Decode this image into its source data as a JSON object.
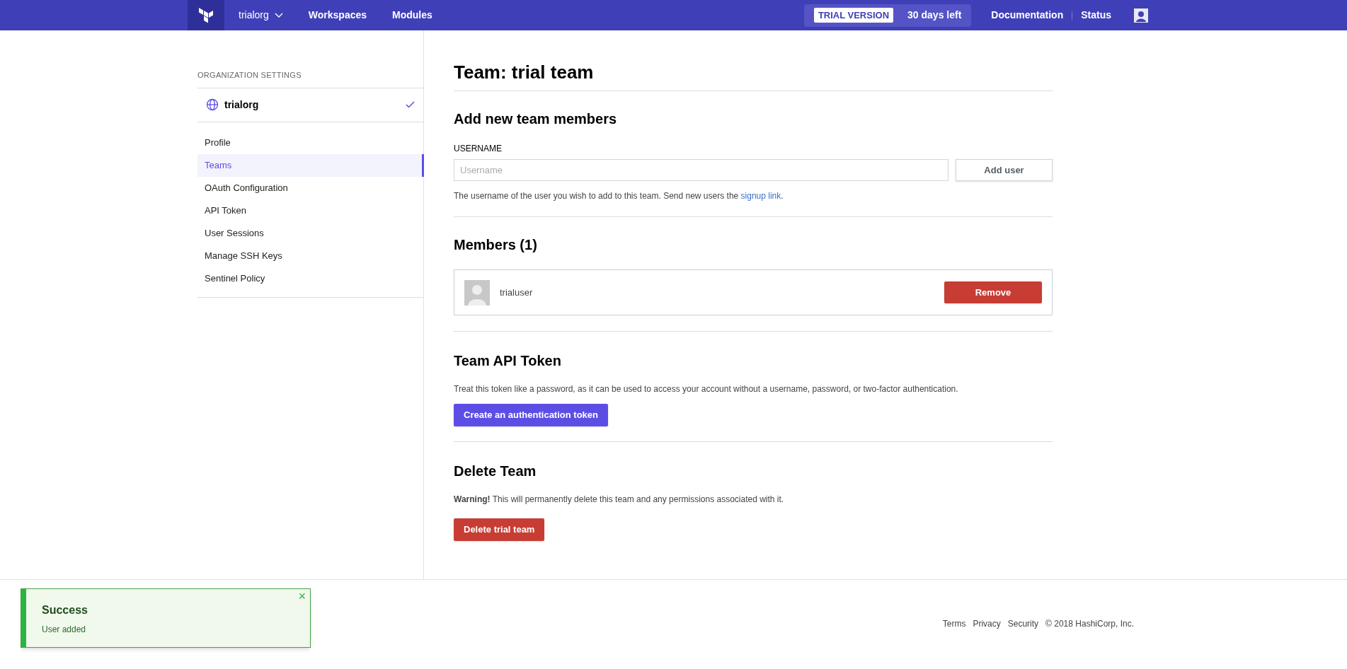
{
  "topbar": {
    "org": "trialorg",
    "nav": [
      {
        "label": "Workspaces"
      },
      {
        "label": "Modules"
      }
    ],
    "trial_badge": "TRIAL VERSION",
    "trial_days": "30 days left",
    "links": [
      {
        "label": "Documentation"
      },
      {
        "label": "Status"
      }
    ]
  },
  "sidebar": {
    "heading": "ORGANIZATION SETTINGS",
    "org": {
      "name": "trialorg",
      "checked": true
    },
    "items": [
      {
        "label": "Profile",
        "selected": false
      },
      {
        "label": "Teams",
        "selected": true
      },
      {
        "label": "OAuth Configuration",
        "selected": false
      },
      {
        "label": "API Token",
        "selected": false
      },
      {
        "label": "User Sessions",
        "selected": false
      },
      {
        "label": "Manage SSH Keys",
        "selected": false
      },
      {
        "label": "Sentinel Policy",
        "selected": false
      }
    ]
  },
  "main": {
    "title": "Team: trial team",
    "add_members": {
      "heading": "Add new team members",
      "field_label": "USERNAME",
      "placeholder": "Username",
      "button": "Add user",
      "help": "The username of the user you wish to add to this team. Send new users the ",
      "help_link": "signup link",
      "help_end": "."
    },
    "members": {
      "heading": "Members (1)",
      "items": [
        {
          "username": "trialuser",
          "button": "Remove"
        }
      ]
    },
    "api_token": {
      "heading": "Team API Token",
      "text": "Treat this token like a password, as it can be used to access your account without a username, password, or two-factor authentication.",
      "button": "Create an authentication token"
    },
    "delete_team": {
      "heading": "Delete Team",
      "warning": "**Warning!** This will permanently delete this team and any permissions associated with it.",
      "button": "Delete trial team"
    }
  },
  "toast": {
    "title": "Success",
    "message": "User added",
    "close": "×"
  },
  "footer": {
    "links": [
      {
        "label": "Terms"
      },
      {
        "label": "Privacy"
      },
      {
        "label": "Security"
      }
    ],
    "copyright": "© 2018 HashiCorp, Inc."
  }
}
